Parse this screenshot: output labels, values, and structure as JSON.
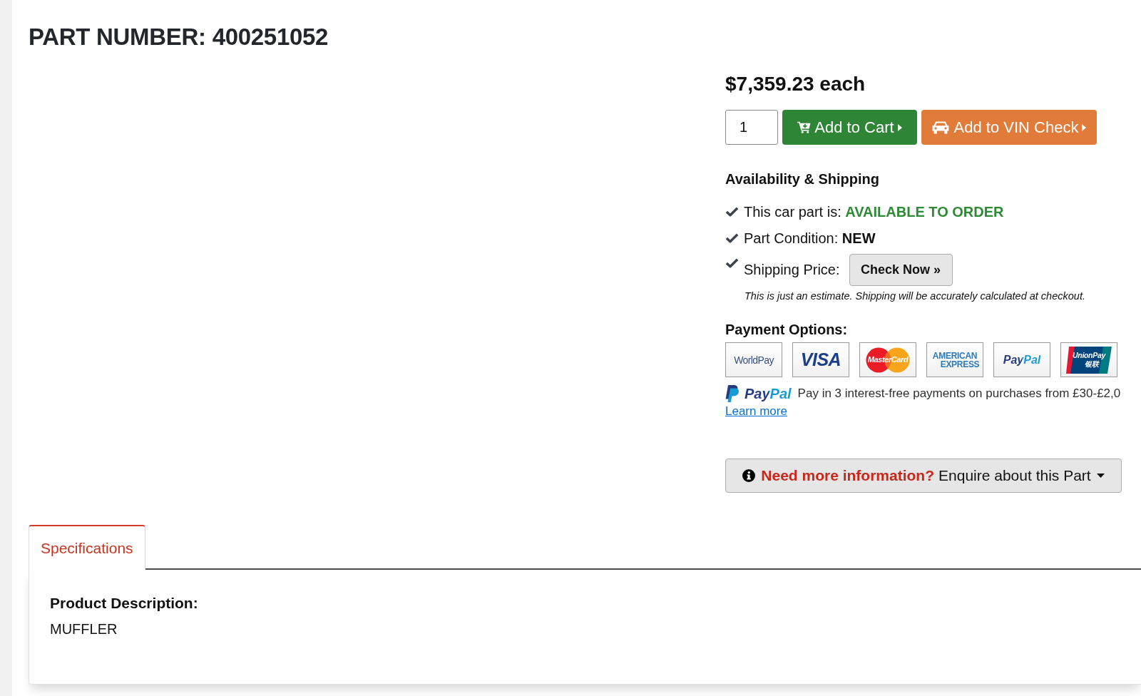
{
  "title": "PART NUMBER: 400251052",
  "price": "$7,359.23 each",
  "quantity": {
    "value": "1"
  },
  "actions": [
    {
      "kind": "cart",
      "label": "Add to Cart"
    },
    {
      "kind": "vin",
      "label": "Add to VIN Check"
    }
  ],
  "availability": {
    "heading": "Availability & Shipping",
    "items": [
      {
        "kind": "status",
        "label": "This car part is:",
        "value": "AVAILABLE TO ORDER"
      },
      {
        "kind": "condition",
        "label": "Part Condition:",
        "value": "NEW"
      },
      {
        "kind": "shipping",
        "label": "Shipping Price:",
        "button": "Check Now »"
      }
    ],
    "note": "This is just an estimate. Shipping will be accurately calculated at checkout."
  },
  "payment": {
    "heading": "Payment Options:",
    "logos": [
      {
        "kind": "worldpay",
        "lines": [
          "WorldPay"
        ]
      },
      {
        "kind": "visa",
        "lines": [
          "VISA"
        ]
      },
      {
        "kind": "mastercard",
        "lines": [
          "MasterCard"
        ]
      },
      {
        "kind": "amex",
        "lines": [
          "AMERICAN",
          "EXPRESS"
        ]
      },
      {
        "kind": "paypal",
        "lines": [
          "PayPal"
        ]
      },
      {
        "kind": "unionpay",
        "lines": [
          "UnionPay",
          "银联"
        ]
      }
    ],
    "paypal_offer": {
      "brand": "PayPal",
      "text": "Pay in 3 interest-free payments on purchases from £30-£2,0",
      "link": "Learn more"
    }
  },
  "enquire": {
    "highlight": "Need more information?",
    "label": "Enquire about this Part"
  },
  "tabs": [
    {
      "label": "Specifications",
      "selected": true
    }
  ],
  "specifications": {
    "heading": "Product Description:",
    "value": "MUFFLER"
  }
}
